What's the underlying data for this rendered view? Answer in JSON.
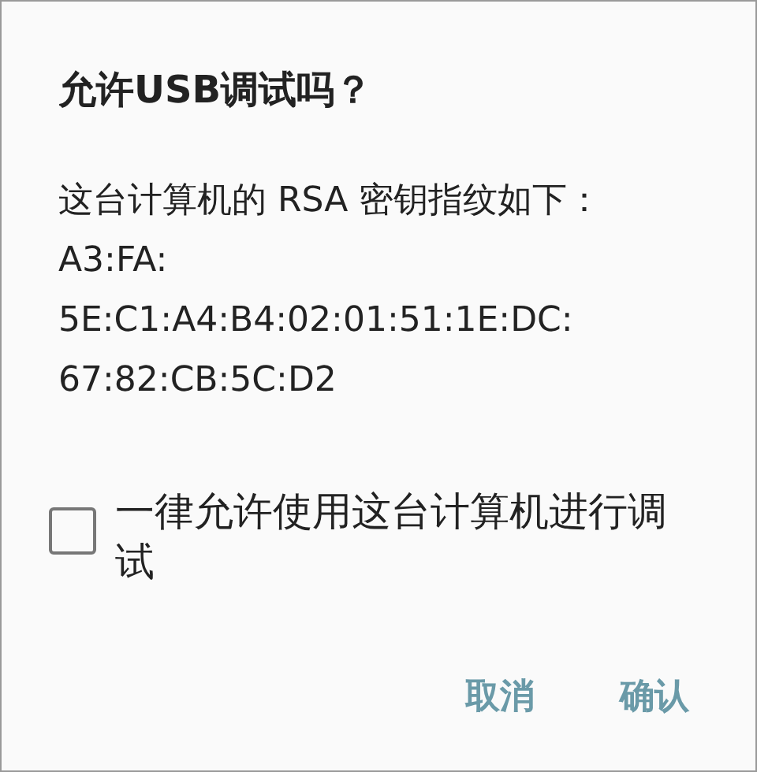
{
  "dialog": {
    "title": "允许USB调试吗？",
    "message_lines": [
      "这台计算机的 RSA 密钥指纹如下：",
      "A3:FA:",
      "5E:C1:A4:B4:02:01:51:1E:DC:",
      "67:82:CB:5C:D2"
    ],
    "checkbox": {
      "label": "一律允许使用这台计算机进行调试",
      "checked": false
    },
    "buttons": [
      "取消",
      "确认"
    ]
  }
}
